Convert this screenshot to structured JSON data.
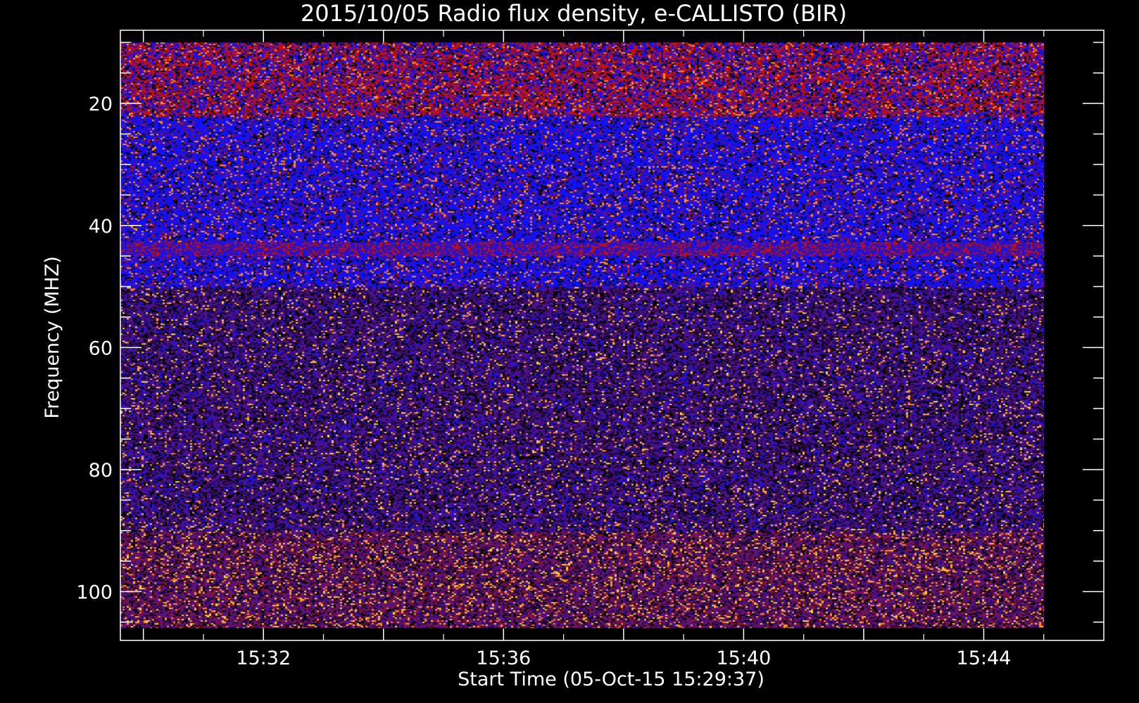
{
  "chart_data": {
    "type": "heatmap",
    "title": "2015/10/05  Radio flux density, e-CALLISTO (BIR)",
    "xlabel": "Start Time (05-Oct-15 15:29:37)",
    "ylabel": "Frequency (MHZ)",
    "x_time_range": [
      "15:29:37",
      "15:45:00"
    ],
    "xlim": [
      "15:29:37",
      "15:46:00"
    ],
    "x_major_ticks": [
      "15:30",
      "15:32",
      "15:34",
      "15:36",
      "15:38",
      "15:40",
      "15:42",
      "15:44"
    ],
    "x_tick_labels": [
      "15:32",
      "15:36",
      "15:40",
      "15:44"
    ],
    "y_range_mhz": [
      10,
      106
    ],
    "ylim": [
      8,
      108
    ],
    "y_axis_inverted": true,
    "y_major_ticks": [
      10,
      15,
      20,
      25,
      30,
      35,
      40,
      45,
      50,
      55,
      60,
      65,
      70,
      75,
      80,
      85,
      90,
      95,
      100,
      105
    ],
    "y_tick_labels": [
      20,
      40,
      60,
      80,
      100
    ],
    "bands": [
      {
        "from_mhz": 10,
        "to_mhz": 22,
        "dominant": "red/blue mix"
      },
      {
        "from_mhz": 22,
        "to_mhz": 50,
        "dominant": "blue"
      },
      {
        "from_mhz": 50,
        "to_mhz": 90,
        "dominant": "purple"
      },
      {
        "from_mhz": 90,
        "to_mhz": 106,
        "dominant": "dark red/purple"
      }
    ],
    "colors": {
      "background": "#000000",
      "axes": "#ffffff",
      "palette": [
        "#000000",
        "#2a0840",
        "#4a1290",
        "#1010ff",
        "#c01010",
        "#ff8a2a",
        "#ffd040"
      ]
    }
  }
}
